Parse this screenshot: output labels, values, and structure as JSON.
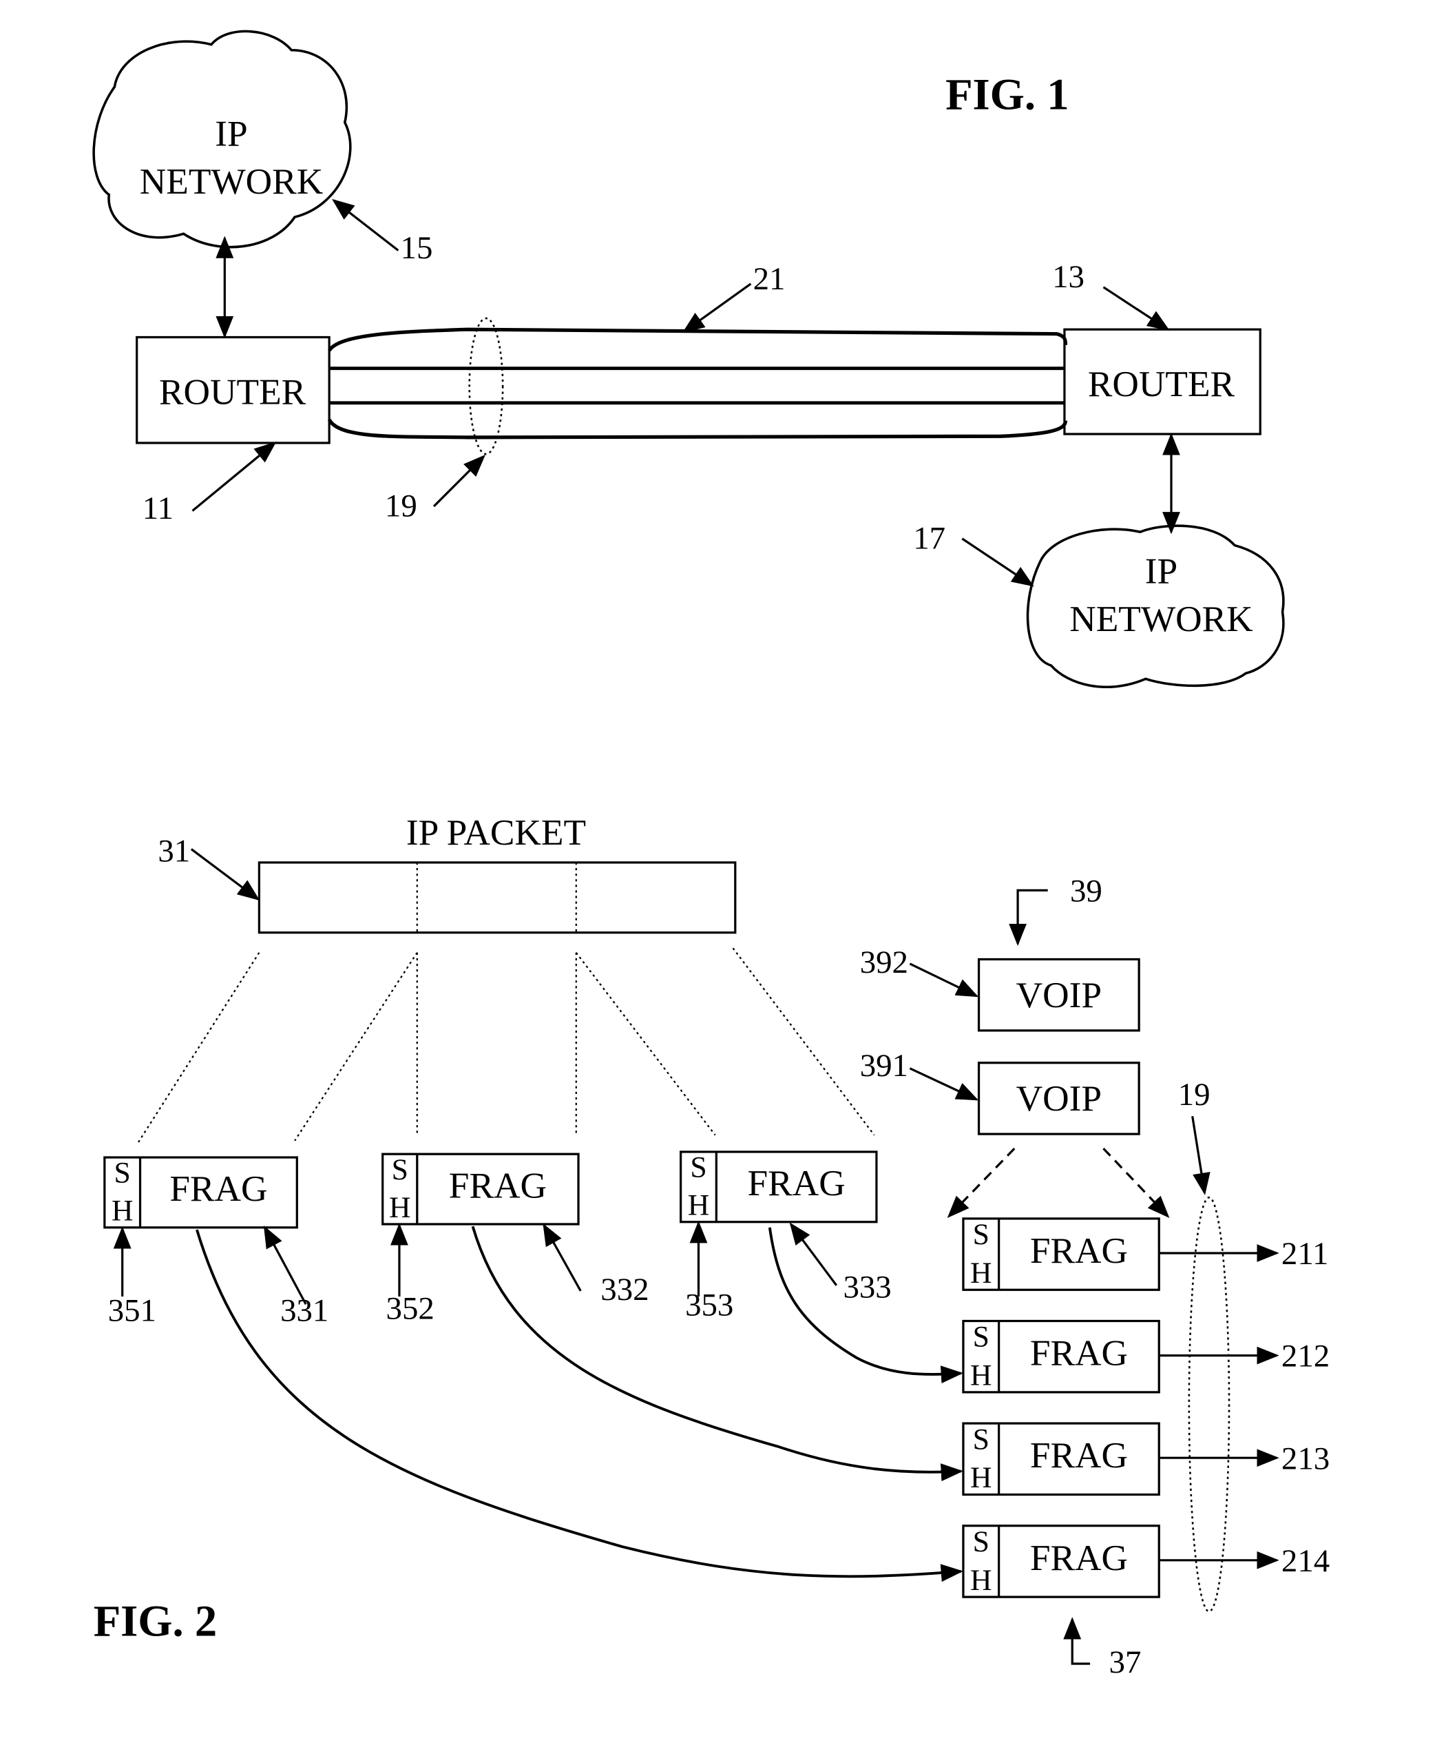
{
  "fig1": {
    "title": "FIG. 1",
    "router_left": {
      "label": "ROUTER",
      "ref": "11"
    },
    "router_right": {
      "label": "ROUTER",
      "ref": "13"
    },
    "network_top": {
      "line1": "IP",
      "line2": "NETWORK",
      "ref": "15"
    },
    "network_bottom": {
      "line1": "IP",
      "line2": "NETWORK",
      "ref": "17"
    },
    "link_bundle_ref": "19",
    "trunk_ref": "21"
  },
  "fig2": {
    "title": "FIG. 2",
    "ip_packet": {
      "label": "IP PACKET",
      "ref": "31",
      "segments": 3
    },
    "source_fragments": [
      {
        "header_top": "S",
        "header_bottom": "H",
        "label": "FRAG",
        "frag_ref": "331",
        "header_ref": "351"
      },
      {
        "header_top": "S",
        "header_bottom": "H",
        "label": "FRAG",
        "frag_ref": "332",
        "header_ref": "352"
      },
      {
        "header_top": "S",
        "header_bottom": "H",
        "label": "FRAG",
        "frag_ref": "333",
        "header_ref": "353"
      }
    ],
    "voip_group_ref": "39",
    "voip_packets": [
      {
        "label": "VOIP",
        "ref": "392"
      },
      {
        "label": "VOIP",
        "ref": "391"
      }
    ],
    "output_fragments": [
      {
        "header_top": "S",
        "header_bottom": "H",
        "label": "FRAG",
        "link_ref": "211"
      },
      {
        "header_top": "S",
        "header_bottom": "H",
        "label": "FRAG",
        "link_ref": "212"
      },
      {
        "header_top": "S",
        "header_bottom": "H",
        "label": "FRAG",
        "link_ref": "213"
      },
      {
        "header_top": "S",
        "header_bottom": "H",
        "label": "FRAG",
        "link_ref": "214"
      }
    ],
    "output_stack_ref": "37",
    "link_bundle_ref": "19"
  }
}
